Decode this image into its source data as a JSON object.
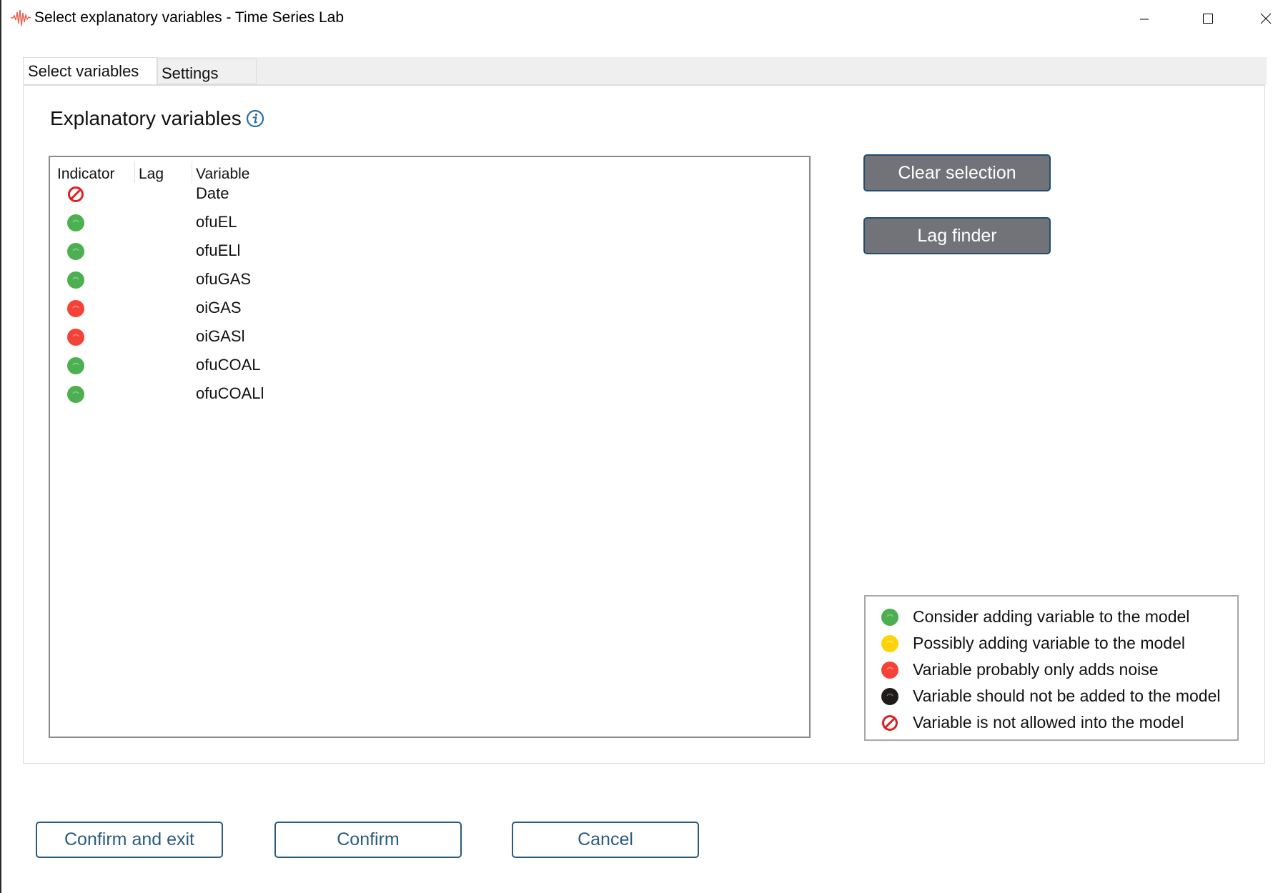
{
  "window": {
    "title": "Select explanatory variables - Time Series Lab",
    "app_icon": "waveform-icon",
    "controls": [
      "minimize",
      "maximize",
      "close"
    ]
  },
  "tabs": [
    {
      "label": "Select variables",
      "active": true
    },
    {
      "label": "Settings",
      "active": false
    }
  ],
  "section": {
    "title": "Explanatory variables",
    "info_icon": "info-icon"
  },
  "table": {
    "columns": [
      "Indicator",
      "Lag",
      "Variable"
    ],
    "rows": [
      {
        "indicator": "not-allowed",
        "lag": "",
        "variable": "Date"
      },
      {
        "indicator": "green",
        "lag": "",
        "variable": "ofuEL"
      },
      {
        "indicator": "green",
        "lag": "",
        "variable": "ofuELl"
      },
      {
        "indicator": "green",
        "lag": "",
        "variable": "ofuGAS"
      },
      {
        "indicator": "red",
        "lag": "",
        "variable": "oiGAS"
      },
      {
        "indicator": "red",
        "lag": "",
        "variable": "oiGASl"
      },
      {
        "indicator": "green",
        "lag": "",
        "variable": "ofuCOAL"
      },
      {
        "indicator": "green",
        "lag": "",
        "variable": "ofuCOALl"
      }
    ]
  },
  "buttons": {
    "clear_selection": "Clear selection",
    "lag_finder": "Lag finder",
    "confirm_and_exit": "Confirm and exit",
    "confirm": "Confirm",
    "cancel": "Cancel"
  },
  "legend": [
    {
      "indicator": "green",
      "label": "Consider adding variable to the model"
    },
    {
      "indicator": "yellow",
      "label": "Possibly adding variable to the model"
    },
    {
      "indicator": "red",
      "label": "Variable probably only adds noise"
    },
    {
      "indicator": "black",
      "label": "Variable should not be added to the model"
    },
    {
      "indicator": "not-allowed",
      "label": "Variable is not allowed into the model"
    }
  ],
  "colors": {
    "green": "#4caf50",
    "yellow": "#fdd40a",
    "red": "#f44336",
    "black": "#1e1a1a",
    "not-allowed": "#e02020",
    "accent": "#2a5a7e",
    "gray_button": "#717379"
  }
}
